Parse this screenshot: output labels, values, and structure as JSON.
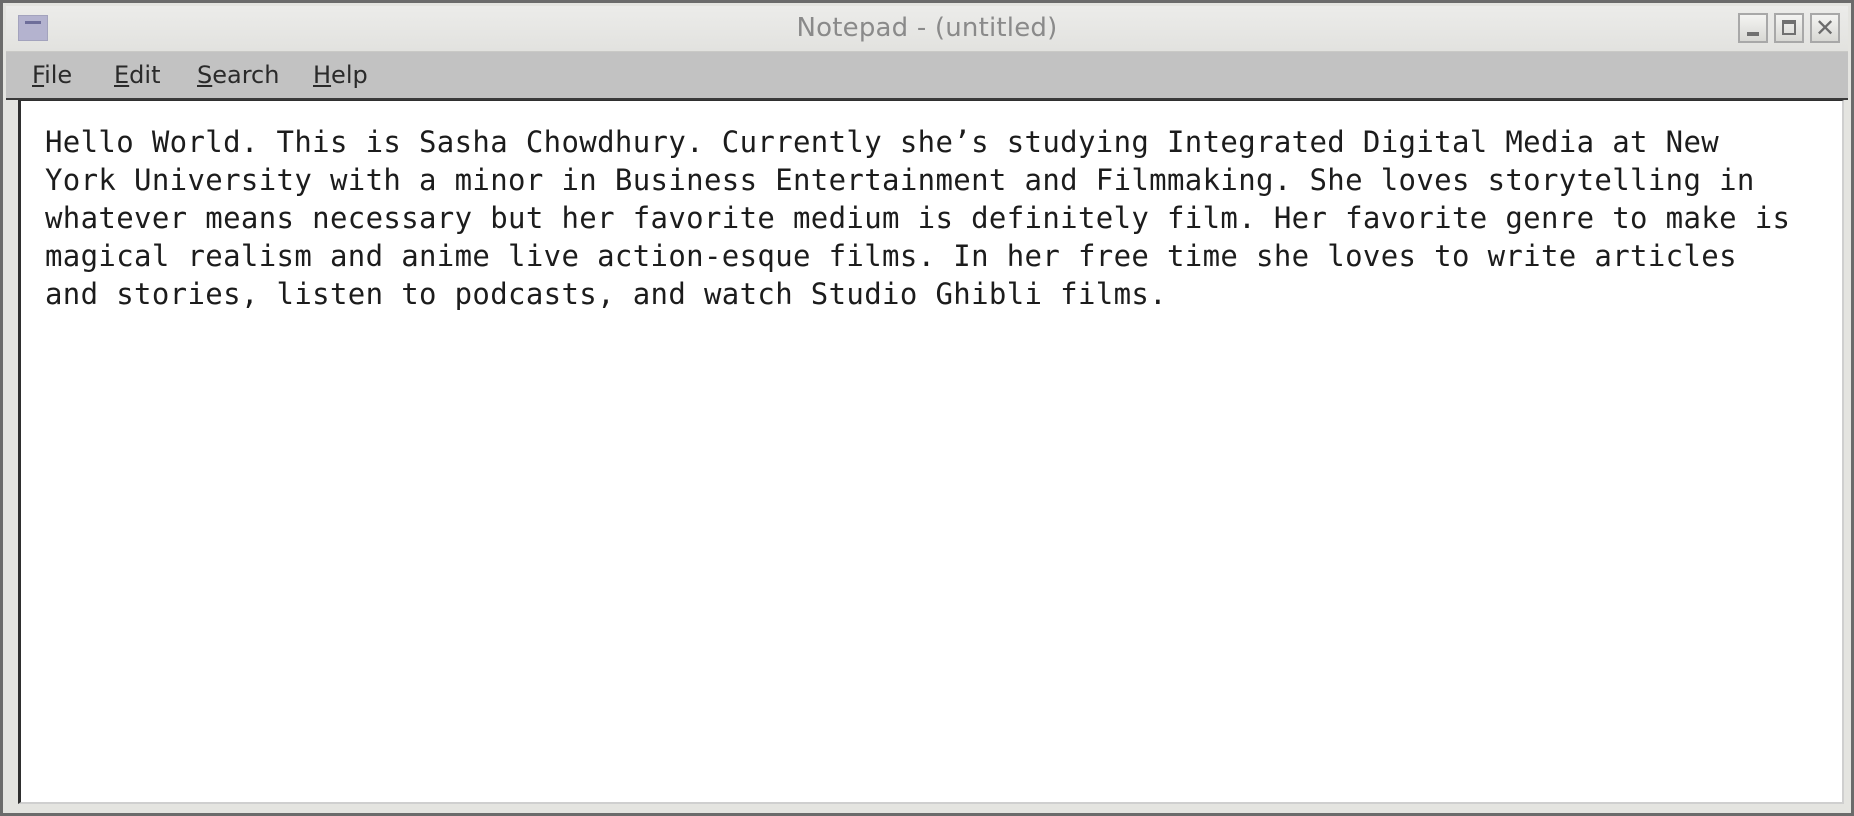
{
  "window": {
    "title": "Notepad - (untitled)"
  },
  "titlebar": {
    "app_icon": "notepad-icon",
    "buttons": {
      "minimize_icon": "minimize-icon",
      "maximize_icon": "maximize-icon",
      "close_icon": "close-icon"
    }
  },
  "menubar": {
    "items": [
      {
        "mnemonic": "F",
        "rest": "ile"
      },
      {
        "mnemonic": "E",
        "rest": "dit"
      },
      {
        "mnemonic": "S",
        "rest": "earch"
      },
      {
        "mnemonic": "H",
        "rest": "elp"
      }
    ]
  },
  "editor": {
    "lines": [
      "Hello World. This is Sasha Chowdhury. Currently she’s studying Integrated Digital Media at New",
      "York University with a minor in Business Entertainment and Filmmaking. She loves storytelling in",
      "whatever means necessary but her favorite medium is definitely film. Her favorite genre to make is",
      "magical realism and anime live action-esque films. In her free time she loves to write articles",
      "and stories, listen to podcasts, and watch Studio Ghibli films."
    ]
  },
  "colors": {
    "menubar_bg": "#c2c2c2",
    "titlebar_bg": "#e8e8e5",
    "title_text": "#8a8a8a",
    "editor_bg": "#ffffff",
    "editor_text": "#1c1c1c"
  }
}
